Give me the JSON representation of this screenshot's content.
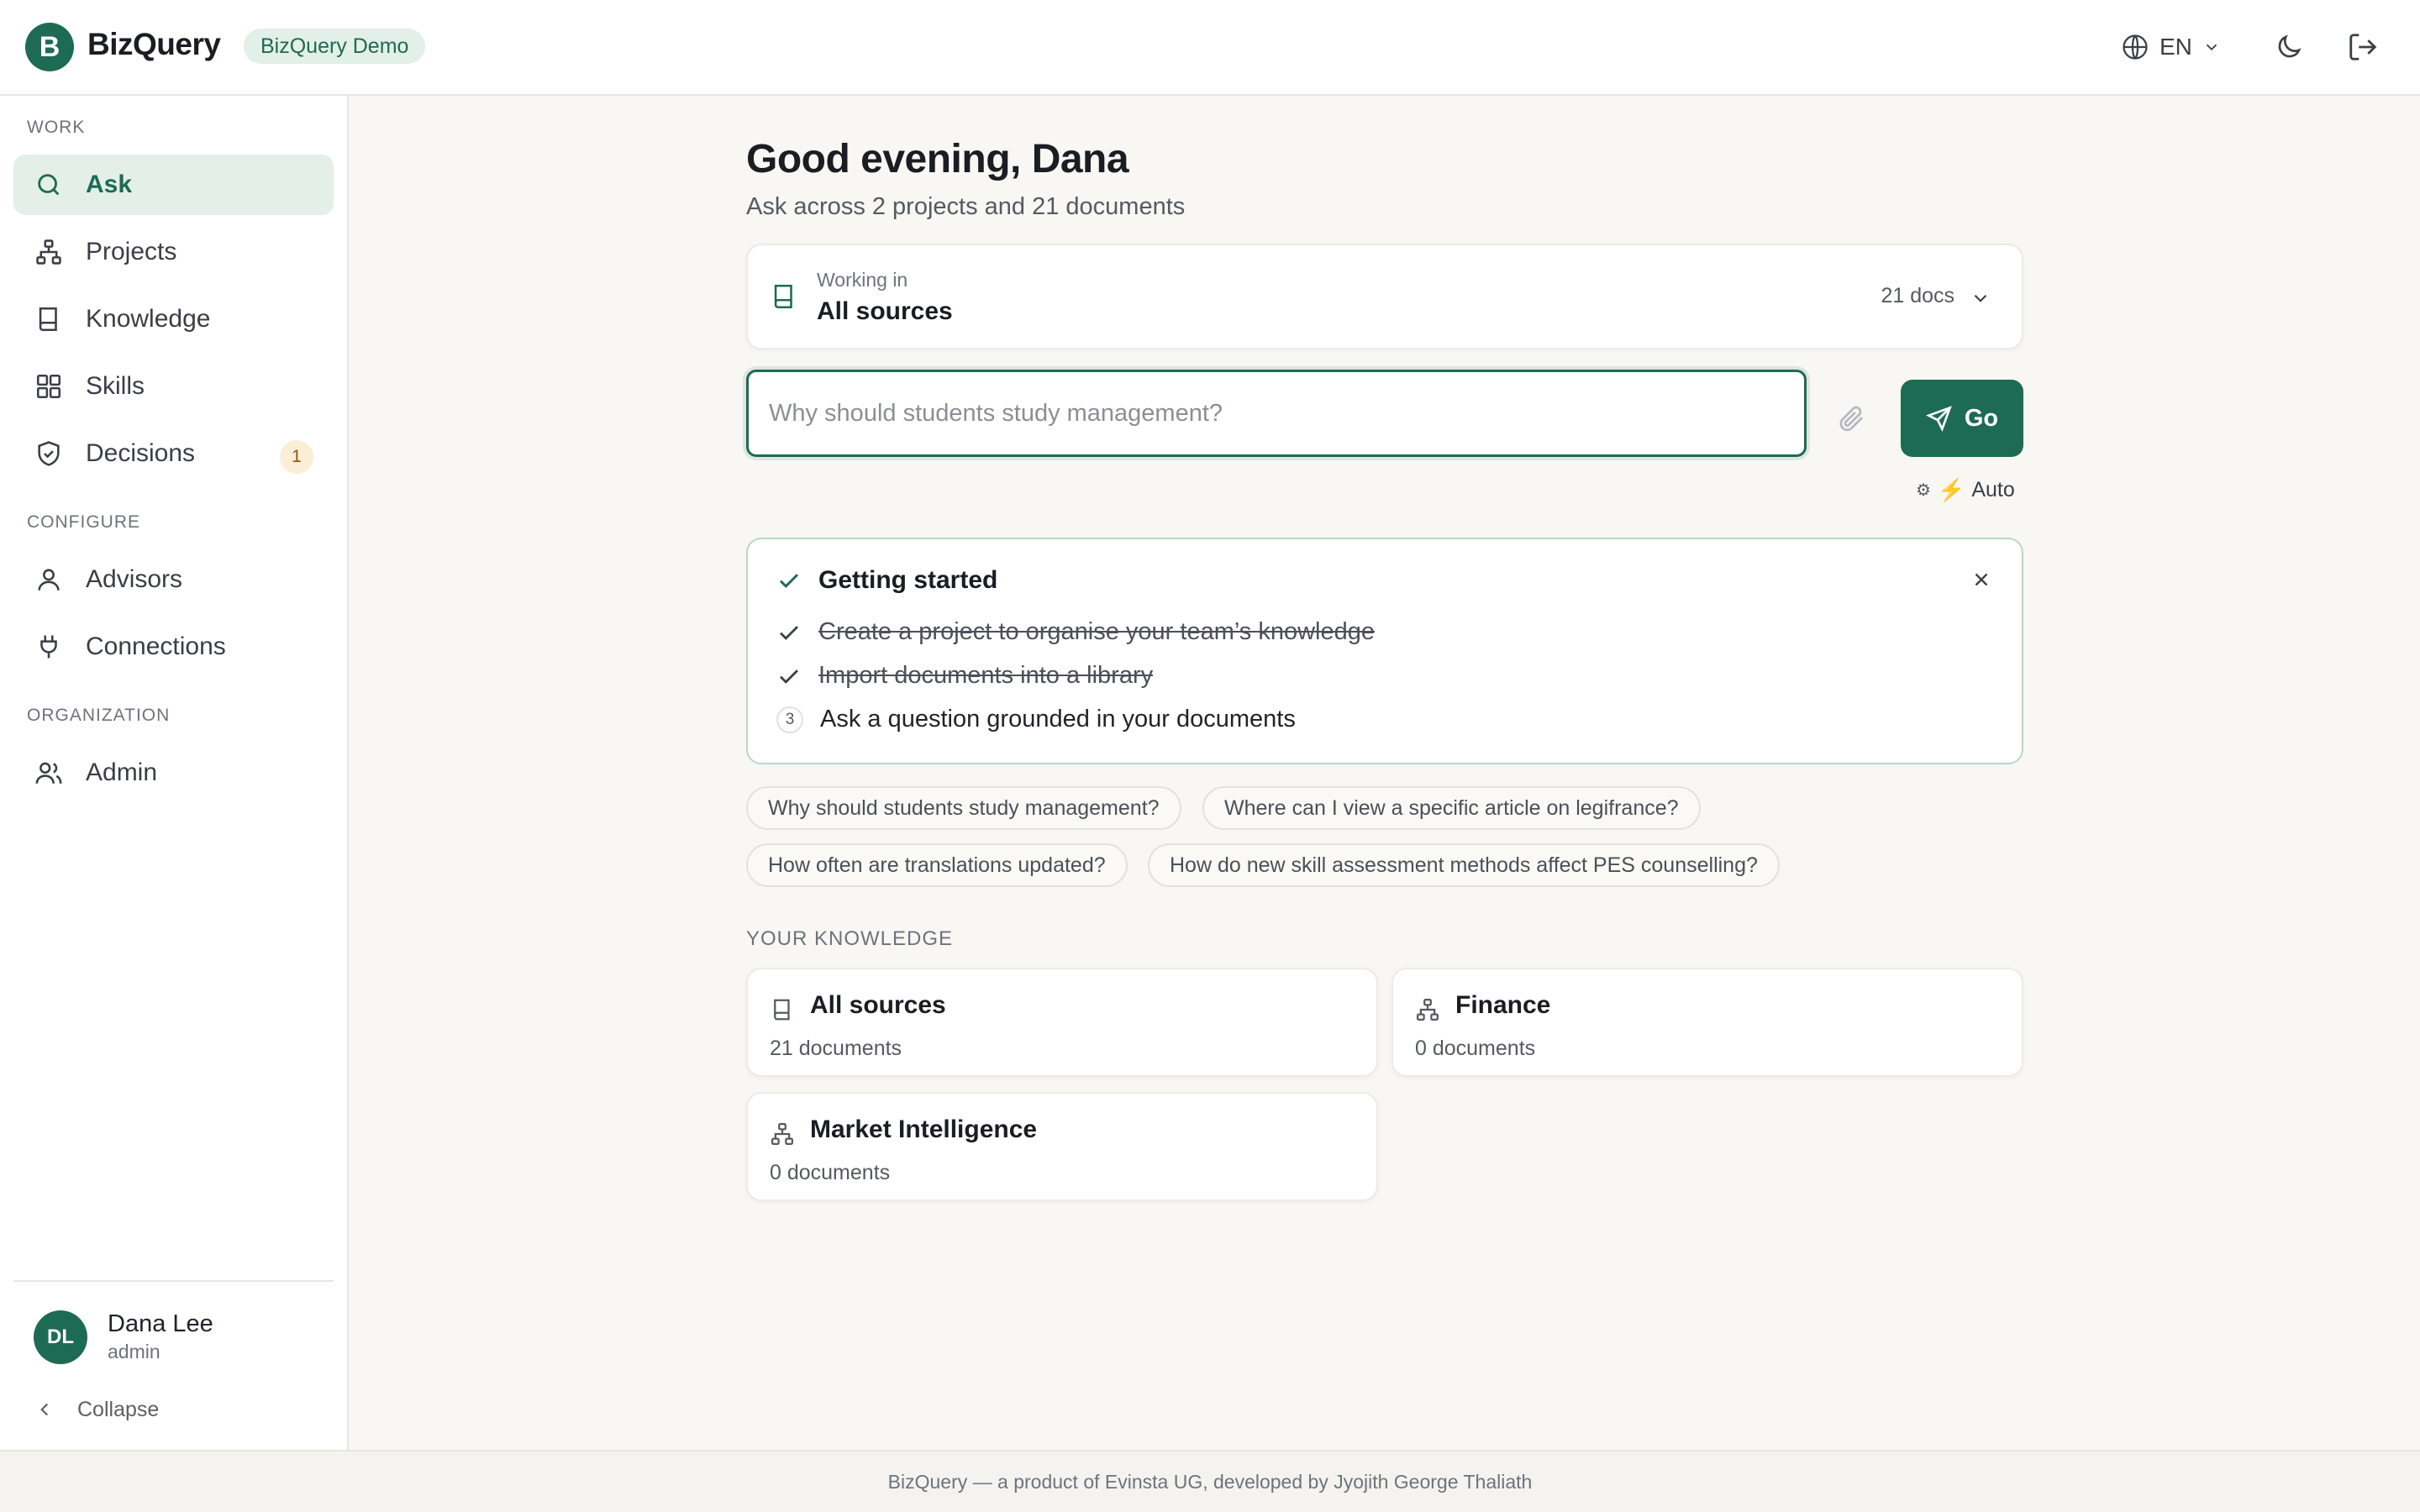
{
  "header": {
    "logo_letter": "B",
    "app_name": "BizQuery",
    "demo_badge": "BizQuery Demo",
    "language": "EN",
    "globe_icon": "globe-icon",
    "theme_icon": "moon-icon",
    "logout_icon": "logout-icon"
  },
  "sidebar": {
    "sections": [
      {
        "label": "WORK",
        "items": [
          {
            "label": "Ask",
            "icon": "search-icon",
            "active": true
          },
          {
            "label": "Projects",
            "icon": "hierarchy-icon"
          },
          {
            "label": "Knowledge",
            "icon": "book-icon"
          },
          {
            "label": "Skills",
            "icon": "grid-icon"
          },
          {
            "label": "Decisions",
            "icon": "shield-check-icon",
            "badge": "1"
          }
        ]
      },
      {
        "label": "CONFIGURE",
        "items": [
          {
            "label": "Advisors",
            "icon": "user-icon"
          },
          {
            "label": "Connections",
            "icon": "plug-icon"
          }
        ]
      },
      {
        "label": "ORGANIZATION",
        "items": [
          {
            "label": "Admin",
            "icon": "users-icon"
          }
        ]
      }
    ],
    "user": {
      "initials": "DL",
      "name": "Dana Lee",
      "role": "admin"
    },
    "collapse_label": "Collapse"
  },
  "main": {
    "greeting": "Good evening, Dana",
    "subtitle": "Ask across 2 projects and 21 documents",
    "scope": {
      "caption": "Working in",
      "value": "All sources",
      "docs": "21 docs"
    },
    "ask": {
      "value": "",
      "placeholder": "Why should students study management?",
      "go_label": "Go",
      "mode_label": "Auto"
    },
    "getting_started": {
      "title": "Getting started",
      "steps": [
        {
          "text": "Create a project to organise your team’s knowledge",
          "done": true
        },
        {
          "text": "Import documents into a library",
          "done": true
        },
        {
          "number": "3",
          "text": "Ask a question grounded in your documents",
          "done": false
        }
      ]
    },
    "suggestions": [
      "Why should students study management?",
      "Where can I view a specific article on legifrance?",
      "How often are translations updated?",
      "How do new skill assessment methods affect PES counselling?"
    ],
    "knowledge": {
      "label": "YOUR KNOWLEDGE",
      "cards": [
        {
          "name": "All sources",
          "count": "21 documents",
          "icon": "book-icon"
        },
        {
          "name": "Finance",
          "count": "0 documents",
          "icon": "hierarchy-icon"
        },
        {
          "name": "Market Intelligence",
          "count": "0 documents",
          "icon": "hierarchy-icon"
        }
      ]
    }
  },
  "footer": {
    "text": "BizQuery — a product of Evinsta UG, developed by Jyojith George Thaliath"
  },
  "colors": {
    "brand": "#1d6b53",
    "active_bg": "#e4efea",
    "badge_bg": "#fbeed6",
    "page_bg": "#f8f7f4"
  }
}
